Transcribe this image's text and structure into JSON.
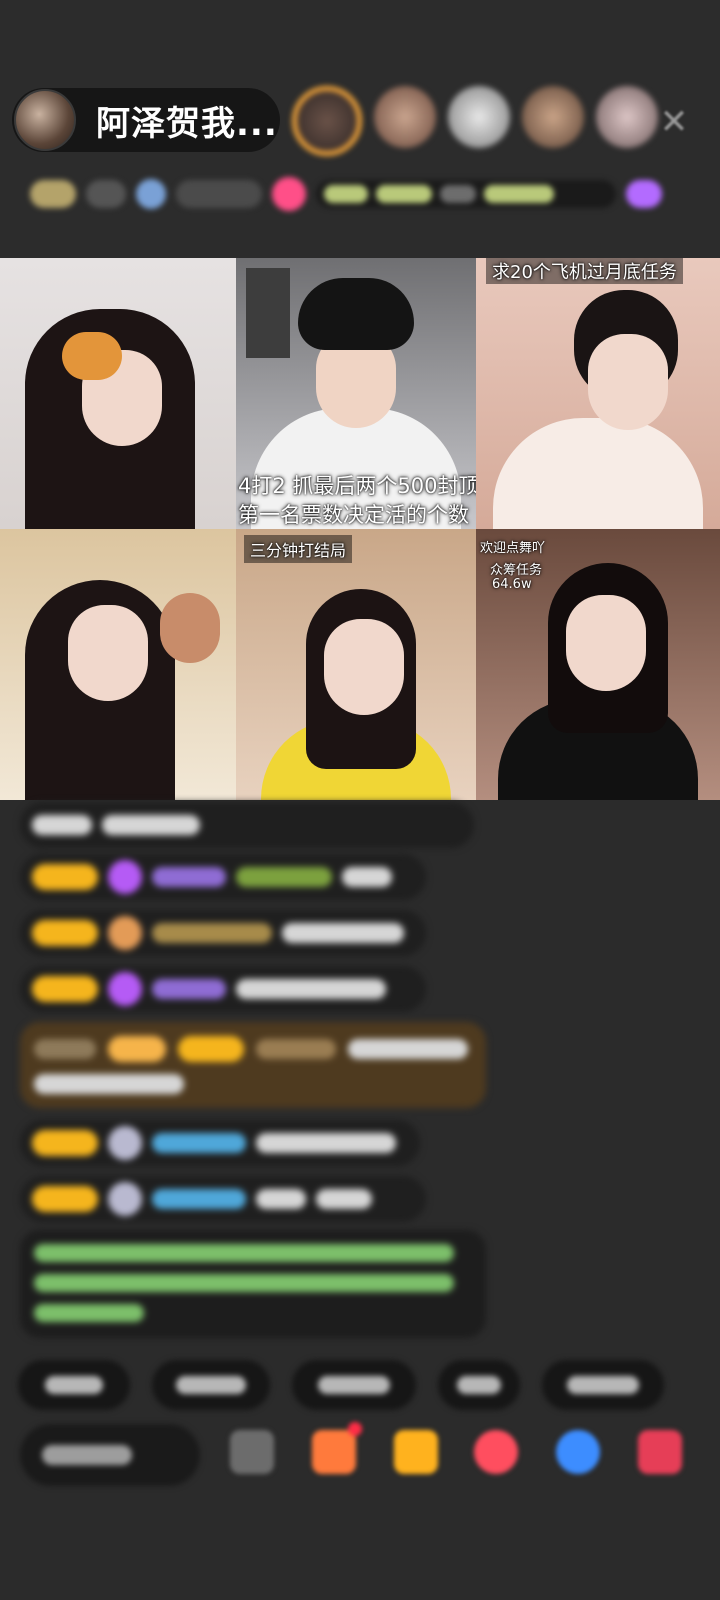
{
  "host": {
    "name": "阿泽贺我..."
  },
  "viewers": [
    "viewer-1",
    "viewer-2",
    "viewer-3",
    "viewer-4",
    "viewer-5"
  ],
  "grid": {
    "cell2_text": [
      "4打2  抓最后两个500封顶",
      "第一名票数决定活的个数"
    ],
    "cell3_text": "求20个飞机过月底任务",
    "cell5_text": "三分钟打结局",
    "cell6_text": [
      "欢迎点舞吖",
      "众筹任务",
      "64.6w"
    ]
  },
  "icons": {
    "close": "close-icon",
    "gem": "gem-icon",
    "gift": "gift-icon"
  }
}
